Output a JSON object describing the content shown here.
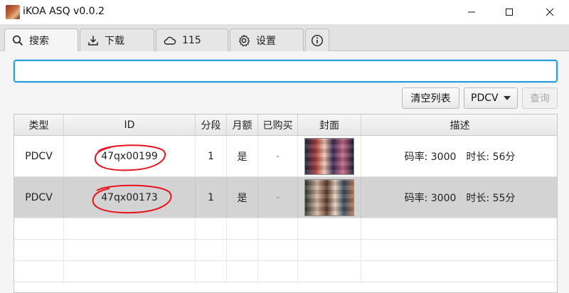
{
  "window": {
    "title": "iKOA ASQ v0.0.2"
  },
  "tabs": [
    {
      "label": "搜索",
      "icon": "search-icon",
      "active": true
    },
    {
      "label": "下载",
      "icon": "download-icon",
      "active": false
    },
    {
      "label": "115",
      "icon": "cloud-icon",
      "active": false
    },
    {
      "label": "设置",
      "icon": "gear-icon",
      "active": false
    },
    {
      "label": "",
      "icon": "info-icon",
      "active": false
    }
  ],
  "search": {
    "value": "",
    "placeholder": ""
  },
  "toolbar": {
    "clear_label": "清空列表",
    "source_value": "PDCV",
    "query_label": "查询"
  },
  "table": {
    "columns": [
      "类型",
      "ID",
      "分段",
      "月额",
      "已购买",
      "封面",
      "描述"
    ],
    "rows": [
      {
        "type": "PDCV",
        "id": "47qx00199",
        "segment": "1",
        "monthly": "是",
        "purchased": "-",
        "description": "码率: 3000　时长: 56分",
        "selected": false
      },
      {
        "type": "PDCV",
        "id": "47qx00173",
        "segment": "1",
        "monthly": "是",
        "purchased": "-",
        "description": "码率: 3000　时长: 55分",
        "selected": true
      }
    ]
  },
  "colors": {
    "accent": "#2a9fd6",
    "annotation": "#e8141c",
    "selected_row": "#d3d3d3"
  }
}
